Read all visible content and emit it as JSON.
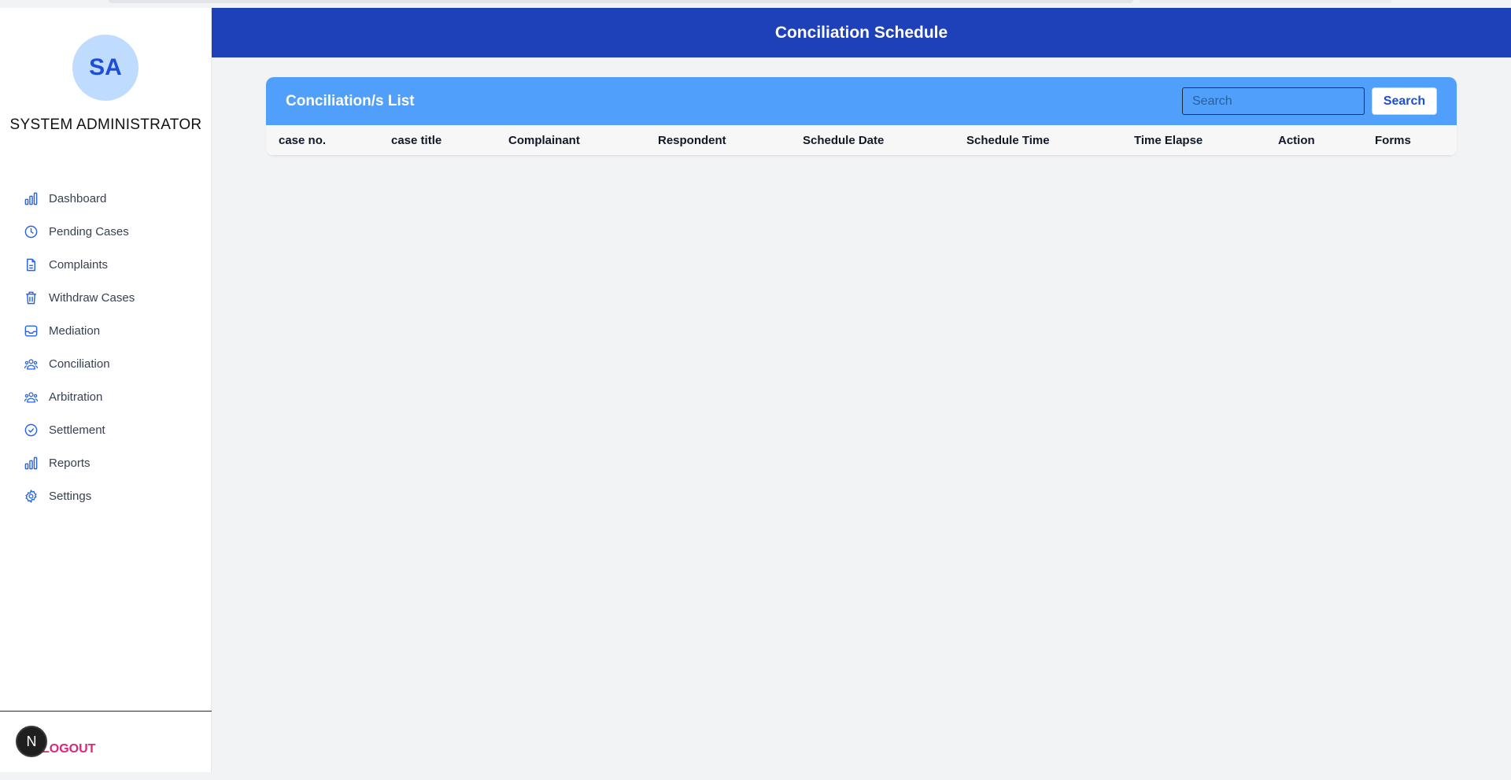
{
  "header": {
    "title": "Conciliation Schedule"
  },
  "sidebar": {
    "avatar_initials": "SA",
    "role": "SYSTEM ADMINISTRATOR",
    "items": [
      {
        "label": "Dashboard",
        "icon": "bar-chart-icon"
      },
      {
        "label": "Pending Cases",
        "icon": "clock-icon"
      },
      {
        "label": "Complaints",
        "icon": "document-icon"
      },
      {
        "label": "Withdraw Cases",
        "icon": "trash-icon"
      },
      {
        "label": "Mediation",
        "icon": "inbox-icon"
      },
      {
        "label": "Conciliation",
        "icon": "users-icon"
      },
      {
        "label": "Arbitration",
        "icon": "users-icon"
      },
      {
        "label": "Settlement",
        "icon": "check-circle-icon"
      },
      {
        "label": "Reports",
        "icon": "bar-chart-icon"
      },
      {
        "label": "Settings",
        "icon": "gear-icon"
      }
    ],
    "logout_label": "LOGOUT",
    "badge_letter": "N"
  },
  "list": {
    "title": "Conciliation/s List",
    "search_placeholder": "Search",
    "search_button": "Search",
    "columns": [
      "case no.",
      "case title",
      "Complainant",
      "Respondent",
      "Schedule Date",
      "Schedule Time",
      "Time Elapse",
      "Action",
      "Forms"
    ],
    "rows": []
  },
  "colors": {
    "header_bg": "#1e40b8",
    "card_header_bg": "#4f9ffb",
    "icon_color": "#2563eb",
    "logout_color": "#db2777",
    "avatar_bg": "#bfdbfe"
  }
}
